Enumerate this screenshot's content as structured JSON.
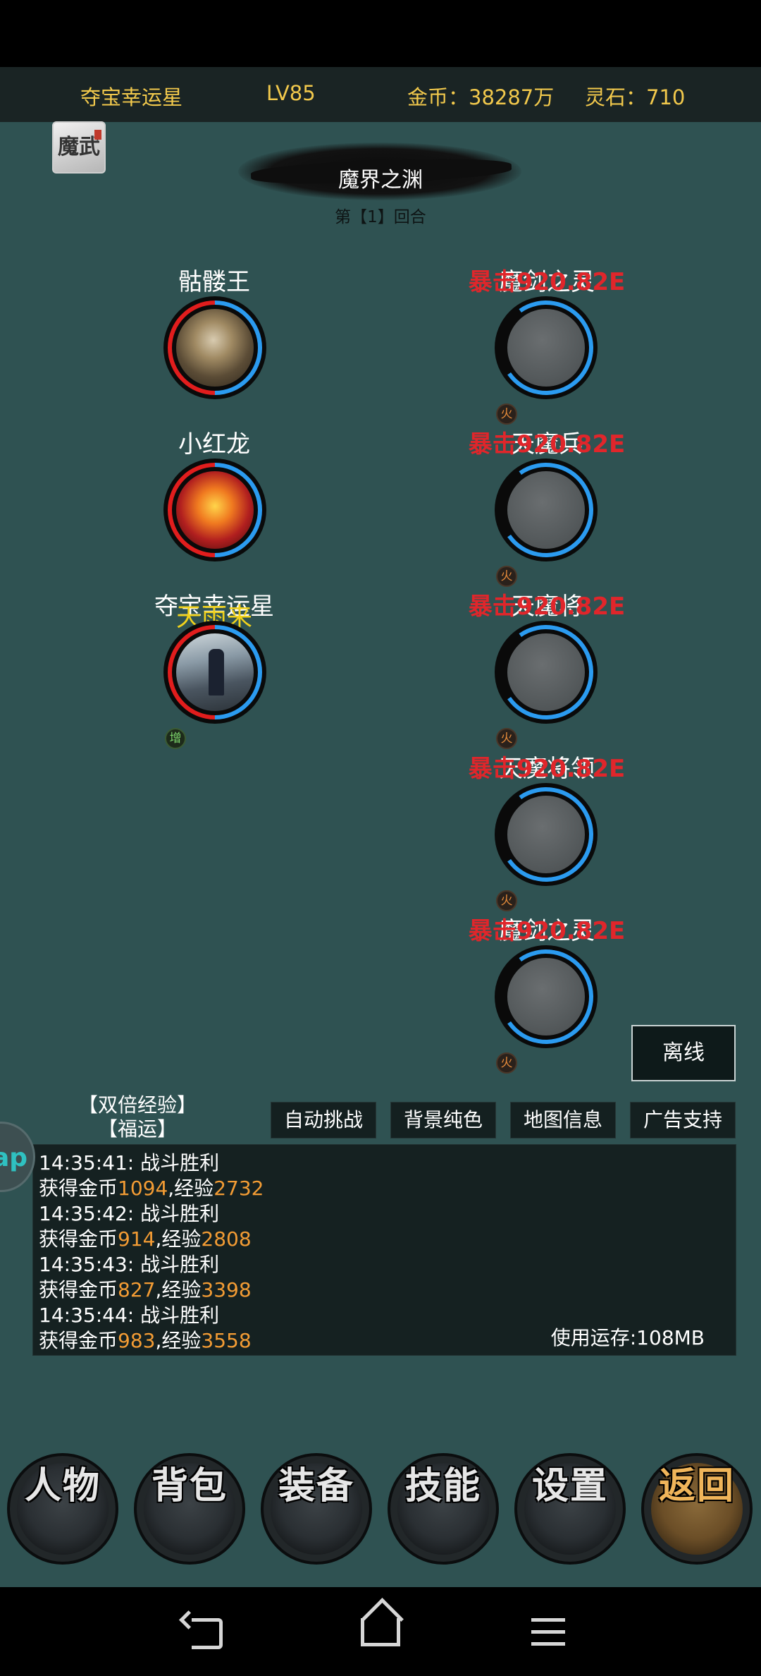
{
  "header": {
    "player_name": "夺宝幸运星",
    "level": "LV85",
    "gold": "金币：38287万",
    "spirit_stones": "灵石：710"
  },
  "map_icon_text": "魔武",
  "stage": {
    "title": "魔界之渊",
    "round": "第【1】回合"
  },
  "allies": [
    {
      "name": "骷髅王"
    },
    {
      "name": "小红龙"
    },
    {
      "name": "夺宝幸运星",
      "float_text": "天雨来",
      "badge": "增"
    }
  ],
  "enemies": [
    {
      "name": "魔剑之灵",
      "damage": "暴击920.82E",
      "element": "火"
    },
    {
      "name": "天魔兵",
      "damage": "暴击920.82E",
      "element": "火"
    },
    {
      "name": "天魔将",
      "damage": "暴击920.82E",
      "element": "火"
    },
    {
      "name": "天魔将领",
      "damage": "暴击920.82E",
      "element": "火"
    },
    {
      "name": "魔剑之灵",
      "damage": "暴击920.82E",
      "element": "火"
    }
  ],
  "offline_button": "离线",
  "perks": [
    "【双倍经验】",
    "【福运】"
  ],
  "controls": [
    "自动挑战",
    "背景纯色",
    "地图信息",
    "广告支持"
  ],
  "side_tab_text": "ap",
  "log": [
    {
      "time": "14:35:41:",
      "text": "战斗胜利"
    },
    {
      "prefix": "获得金币",
      "gold": "1094",
      "mid": ",经验",
      "exp": "2732"
    },
    {
      "time": "14:35:42:",
      "text": "战斗胜利"
    },
    {
      "prefix": "获得金币",
      "gold": "914",
      "mid": ",经验",
      "exp": "2808"
    },
    {
      "time": "14:35:43:",
      "text": "战斗胜利"
    },
    {
      "prefix": "获得金币",
      "gold": "827",
      "mid": ",经验",
      "exp": "3398"
    },
    {
      "time": "14:35:44:",
      "text": "战斗胜利"
    },
    {
      "prefix": "获得金币",
      "gold": "983",
      "mid": ",经验",
      "exp": "3558"
    }
  ],
  "memory_usage": "使用运存:108MB",
  "bottom_menu": [
    {
      "label": "人物",
      "active": false
    },
    {
      "label": "背包",
      "active": false
    },
    {
      "label": "装备",
      "active": false
    },
    {
      "label": "技能",
      "active": false
    },
    {
      "label": "设置",
      "active": false
    },
    {
      "label": "返回",
      "active": true
    }
  ],
  "colors": {
    "background": "#2f5252",
    "gold_text": "#f2c94c",
    "damage_red": "#e0262b",
    "hp_ring": "#e11d1d",
    "mp_ring": "#2b9bf0",
    "log_number": "#f39c34"
  }
}
